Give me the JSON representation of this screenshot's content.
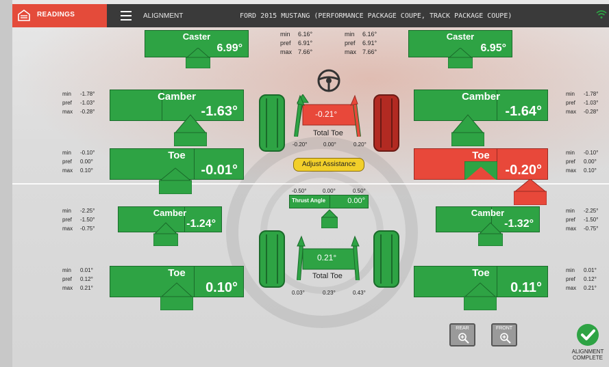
{
  "header": {
    "readings_tab": "READINGS",
    "alignment_label": "ALIGNMENT",
    "vehicle": "FORD 2015 MUSTANG (PERFORMANCE PACKAGE COUPE, TRACK PACKAGE COUPE)",
    "icons": {
      "home": "home-icon",
      "menu": "menu-icon",
      "wifi": "wifi-icon"
    }
  },
  "colors": {
    "green": "#2ea344",
    "red": "#e8483a",
    "yellow": "#f2cf2a",
    "topbar": "#3a3a3a"
  },
  "front": {
    "caster_left": {
      "title": "Caster",
      "value": "6.99°"
    },
    "caster_right": {
      "title": "Caster",
      "value": "6.95°"
    },
    "caster_range_left": {
      "min": "6.16°",
      "pref": "6.91°",
      "max": "7.66°"
    },
    "caster_range_right": {
      "min": "6.16°",
      "pref": "6.91°",
      "max": "7.66°"
    },
    "camber_left": {
      "title": "Camber",
      "value": "-1.63°",
      "range": {
        "min": "-1.78°",
        "pref": "-1.03°",
        "max": "-0.28°"
      }
    },
    "camber_right": {
      "title": "Camber",
      "value": "-1.64°",
      "range": {
        "min": "-1.78°",
        "pref": "-1.03°",
        "max": "-0.28°"
      }
    },
    "toe_left": {
      "title": "Toe",
      "value": "-0.01°",
      "range": {
        "min": "-0.10°",
        "pref": "0.00°",
        "max": "0.10°"
      }
    },
    "toe_right": {
      "title": "Toe",
      "value": "-0.20°",
      "range": {
        "min": "-0.10°",
        "pref": "0.00°",
        "max": "0.10°"
      }
    },
    "total_toe": {
      "value": "-0.21°",
      "label": "Total Toe",
      "min": "-0.20°",
      "pref": "0.00°",
      "max": "0.20°"
    },
    "adjust_button": "Adjust Assistance",
    "steering_icon": "steering-wheel-icon"
  },
  "rear": {
    "thrust": {
      "label": "Thrust Angle",
      "value": "0.00°",
      "min": "-0.50°",
      "pref": "0.00°",
      "max": "0.50°"
    },
    "camber_left": {
      "title": "Camber",
      "value": "-1.24°",
      "range": {
        "min": "-2.25°",
        "pref": "-1.50°",
        "max": "-0.75°"
      }
    },
    "camber_right": {
      "title": "Camber",
      "value": "-1.32°",
      "range": {
        "min": "-2.25°",
        "pref": "-1.50°",
        "max": "-0.75°"
      }
    },
    "toe_left": {
      "title": "Toe",
      "value": "0.10°",
      "range": {
        "min": "0.01°",
        "pref": "0.12°",
        "max": "0.21°"
      }
    },
    "toe_right": {
      "title": "Toe",
      "value": "0.11°",
      "range": {
        "min": "0.01°",
        "pref": "0.12°",
        "max": "0.21°"
      }
    },
    "total_toe": {
      "value": "0.21°",
      "label": "Total Toe",
      "min": "0.03°",
      "pref": "0.23°",
      "max": "0.43°"
    }
  },
  "labels": {
    "min": "min",
    "pref": "pref",
    "max": "max"
  },
  "footer": {
    "rear_zoom": "REAR",
    "front_zoom": "FRONT",
    "complete_line1": "ALIGNMENT",
    "complete_line2": "COMPLETE"
  }
}
